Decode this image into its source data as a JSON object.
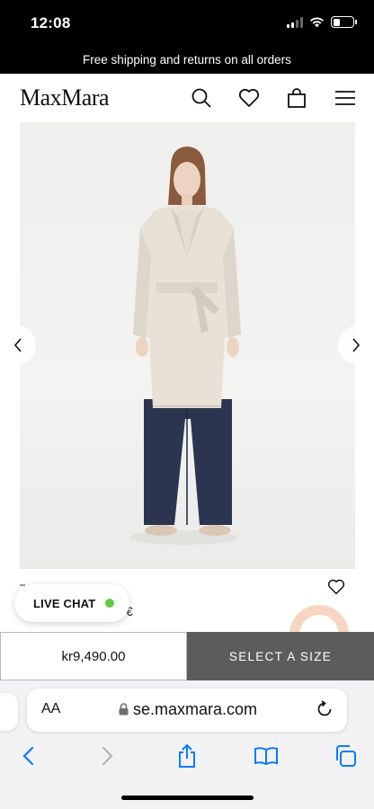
{
  "status_bar": {
    "time": "12:08"
  },
  "promo": {
    "text": "Free shipping and returns on all orders"
  },
  "header": {
    "logo": "MaxMara",
    "icons": [
      "search-icon",
      "heart-icon",
      "bag-icon",
      "menu-icon"
    ]
  },
  "product": {
    "image_description_icon": "coat-figure",
    "name_fragment": "€",
    "price": "kr9,490.00",
    "select_size_label": "SELECT A SIZE"
  },
  "live_chat": {
    "label": "LIVE CHAT",
    "status_color": "#62cd3e"
  },
  "browser": {
    "text_size_label": "AA",
    "url": "se.maxmara.com",
    "toolbar": [
      "back-icon",
      "forward-icon",
      "share-icon",
      "bookmarks-icon",
      "tabs-icon"
    ]
  },
  "colors": {
    "accent_blue": "#0a7aff",
    "select_size_bg": "#5c5c5c",
    "chat_badge": "#f6d5c2"
  }
}
